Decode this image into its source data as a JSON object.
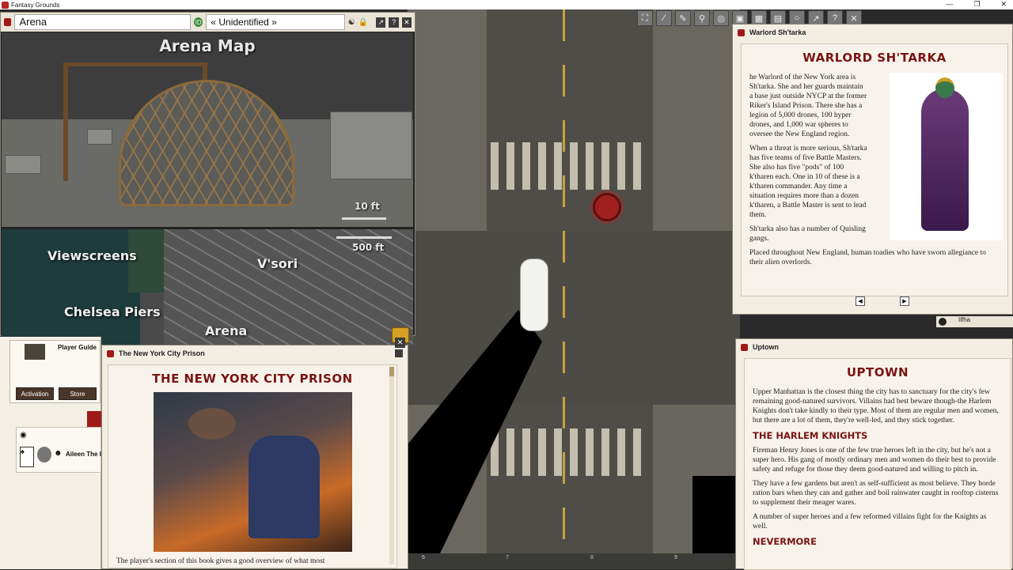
{
  "app": {
    "title": "Fantasy Grounds"
  },
  "arena_window": {
    "name_value": "Arena",
    "identity_value": "« Unidentified »",
    "map_title": "Arena Map",
    "scale_small": "10 ft",
    "scale_large": "500 ft",
    "city_labels": [
      "Viewscreens",
      "V'sori",
      "Chelsea Piers",
      "Arena"
    ]
  },
  "left_panel": {
    "guide_label": "Player Guide",
    "activation_label": "Activation",
    "store_label": "Store",
    "character_name": "Aileen The I"
  },
  "nyc_window": {
    "title": "The New York City Prison",
    "heading": "THE NEW YORK CITY PRISON",
    "body": "The player's section of this book gives a good overview of what most"
  },
  "warlord_window": {
    "title": "Warlord Sh'tarka",
    "heading": "WARLORD SH'TARKA",
    "p1": "he Warlord of the New York area is Sh'tarka. She and her guards maintain a base just outside NYCP at the former Riker's Island Prison. There she has a legion of 5,000 drones, 100 hyper drones, and 1,000 war spheres to oversee the New England region.",
    "p2": "When a threat is more serious, Sh'tarka has five teams of five Battle Masters. She also has five \"pods\" of 100 k'tharen each. One in 10 of these is a k'tharen commander. Any time a situation requires more than a dozen k'tharen, a Battle Master is sent to lead them.",
    "p3": "Sh'tarka also has a number of Quisling gangs.",
    "p4": "Placed throughout New England, human toadies who have sworn allegiance to their alien overlords."
  },
  "float_tag": {
    "label": "Ilfha"
  },
  "uptown_window": {
    "title": "Uptown",
    "heading": "UPTOWN",
    "p1": "Upper Manhattan is the closest thing the city has to sanctuary for the city's few remaining good-natured survivors. Villains had best beware though-the Harlem Knights don't take kindly to their type. Most of them are regular men and women, but there are a lot of them, they're well-led, and they stick together.",
    "h2": "THE HARLEM KNIGHTS",
    "p2": "Fireman Henry Jones is one of the few true heroes left in the city, but he's not a super hero. His gang of mostly ordinary men and women do their best to provide safety and refuge for those they deem good-natured and willing to pitch in.",
    "p3": "They have a few gardens but aren't as self-sufficient as most believe. They horde ration bars when they can and gather and boil rainwater caught in rooftop cisterns to supplement their meager wares.",
    "p4": "A number of super heroes and a few reformed villains fight for the Knights as well.",
    "h3": "NEVERMORE"
  },
  "map": {
    "ruler_ticks": [
      "6",
      "7",
      "8",
      "9"
    ]
  }
}
